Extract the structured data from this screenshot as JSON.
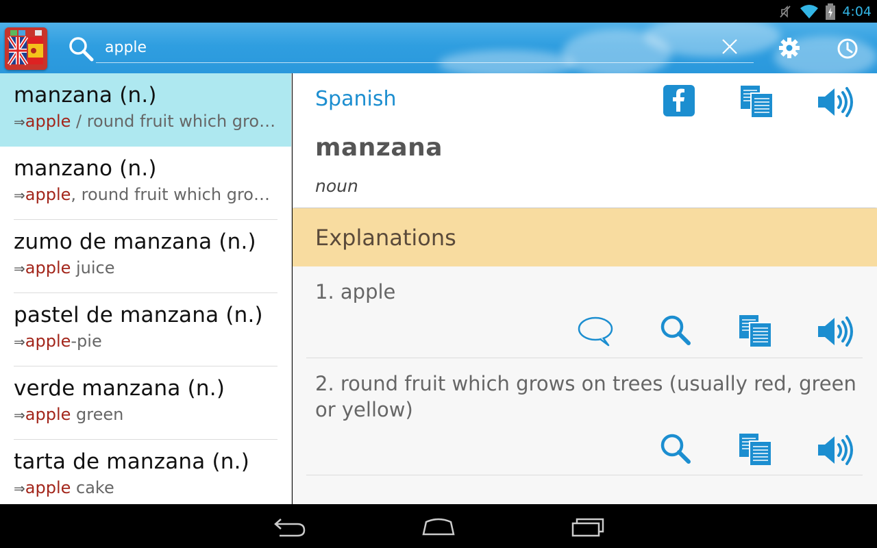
{
  "status_bar": {
    "time": "4:04",
    "icons": [
      "muted-icon",
      "wifi-icon",
      "battery-charging-icon"
    ]
  },
  "action_bar": {
    "search_value": "apple",
    "icons": [
      "app-logo-flags",
      "search-icon",
      "clear-icon",
      "settings-icon",
      "history-icon"
    ]
  },
  "results": [
    {
      "term": "manzana (n.)",
      "highlight": "apple",
      "rest": " / round fruit which grows on trees",
      "selected": true
    },
    {
      "term": "manzano (n.)",
      "highlight": "apple",
      "rest": ", round fruit which grows on trees",
      "selected": false
    },
    {
      "term": "zumo de manzana (n.)",
      "highlight": "apple",
      "rest": " juice",
      "selected": false
    },
    {
      "term": "pastel de manzana (n.)",
      "highlight": "apple",
      "rest": "-pie",
      "selected": false
    },
    {
      "term": "verde manzana (n.)",
      "highlight": "apple",
      "rest": " green",
      "selected": false
    },
    {
      "term": "tarta de manzana (n.)",
      "highlight": "apple",
      "rest": " cake",
      "selected": false
    }
  ],
  "arrow_glyph": "⇒",
  "detail": {
    "language": "Spanish",
    "headword": "manzana",
    "part_of_speech": "noun",
    "section_title": "Explanations",
    "explanations": [
      {
        "text": "1. apple",
        "actions": [
          "comment-icon",
          "search-icon",
          "copy-icon",
          "speaker-icon"
        ]
      },
      {
        "text": "2. round fruit which grows on trees (usually red, green or yellow)",
        "actions": [
          "search-icon",
          "copy-icon",
          "speaker-icon"
        ]
      }
    ]
  },
  "colors": {
    "accent_blue": "#1c8ed0",
    "selected_row": "#aee8f0",
    "highlight_red": "#a3261b",
    "section_header": "#f8dca0",
    "status_blue": "#33b5e5"
  },
  "nav_bar": {
    "buttons": [
      "back-icon",
      "home-icon",
      "recent-apps-icon"
    ]
  }
}
